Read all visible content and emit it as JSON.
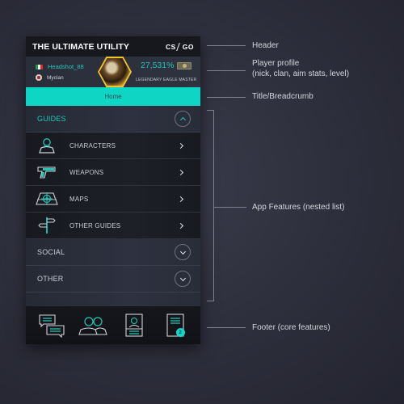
{
  "app": {
    "title": "THE ULTIMATE UTILITY",
    "logo_left": "CS",
    "logo_right": "GO"
  },
  "profile": {
    "nick": "Headshot_88",
    "flag": "italy-flag",
    "clan": "Myclan",
    "aim_stat": "27,531%",
    "level": "LEGENDARY  EAGLE MASTER"
  },
  "breadcrumb": {
    "label": "Home"
  },
  "menu": {
    "sections": [
      {
        "label": "GUIDES",
        "expanded": true,
        "items": [
          {
            "label": "CHARACTERS",
            "icon": "character-icon"
          },
          {
            "label": "WEAPONS",
            "icon": "pistol-icon"
          },
          {
            "label": "MAPS",
            "icon": "map-target-icon"
          },
          {
            "label": "OTHER GUIDES",
            "icon": "signpost-icon"
          }
        ]
      },
      {
        "label": "SOCIAL",
        "expanded": false
      },
      {
        "label": "OTHER",
        "expanded": false
      }
    ]
  },
  "footer": {
    "items": [
      {
        "name": "chat",
        "icon": "chat-icon"
      },
      {
        "name": "friends",
        "icon": "friends-icon"
      },
      {
        "name": "profile-card",
        "icon": "profile-card-icon"
      },
      {
        "name": "notes",
        "icon": "document-icon",
        "badge": "2"
      }
    ]
  },
  "annotations": {
    "header": "Header",
    "profile_line1": "Player profile",
    "profile_line2": "(nick, clan, aim stats, level)",
    "breadcrumb": "Title/Breadcrumb",
    "features": "App Features (nested list)",
    "footer": "Footer (core features)"
  },
  "colors": {
    "accent": "#0fd5c5",
    "accent_text": "#21c7b6",
    "background": "#2d2e3b",
    "panel": "#1c1e26"
  }
}
